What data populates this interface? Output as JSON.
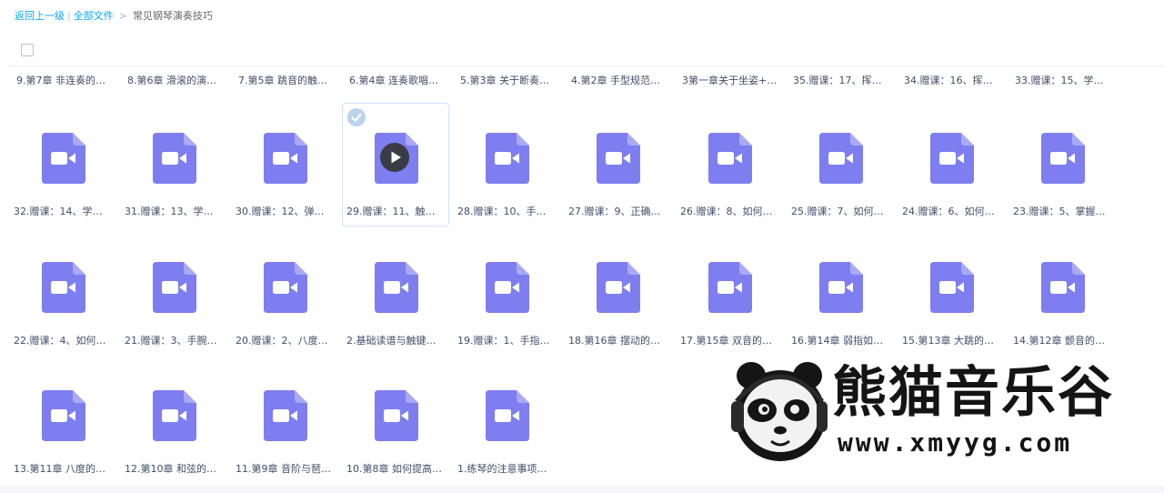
{
  "breadcrumb": {
    "back": "返回上一级",
    "separator": "|",
    "all_files": "全部文件",
    "chevron": ">",
    "current": "常见钢琴演奏技巧"
  },
  "top_row": [
    "9.第7章 非连奏的…",
    "8.第6章 滑滚的演…",
    "7.第5章 跳音的触…",
    "6.第4章 连奏歌唱…",
    "5.第3章 关于断奏…",
    "4.第2章 手型规范…",
    "3第一章关于坐姿+…",
    "35.赠课：17、挥…",
    "34.赠课：16、挥…",
    "33.赠课：15、学…"
  ],
  "rows": [
    [
      "32.赠课：14、学…",
      "31.赠课：13、学…",
      "30.赠课：12、弹…",
      "29.赠课：11、触…",
      "28.赠课：10、手…",
      "27.赠课：9、正确…",
      "26.赠课：8、如何…",
      "25.赠课：7、如何…",
      "24.赠课：6、如何…",
      "23.赠课：5、掌握…"
    ],
    [
      "22.赠课：4、如何…",
      "21.赠课：3、手腕…",
      "20.赠课：2、八度…",
      "2.基础读谱与触键…",
      "19.赠课：1、手指…",
      "18.第16章 摆动的…",
      "17.第15章 双音的…",
      "16.第14章 弱指如…",
      "15.第13章 大跳的…",
      "14.第12章 颤音的…"
    ],
    [
      "13.第11章 八度的…",
      "12.第10章 和弦的…",
      "11.第9章 音阶与琶…",
      "10.第8章 如何提高…",
      "1.练琴的注意事项…"
    ]
  ],
  "file_icon": "video-file-icon",
  "selected_file": "29.赠课：11、触…",
  "colors": {
    "accent": "#06a7ff",
    "file_icon": "#7e7ef0",
    "file_icon_fold": "#a9a9f6",
    "text": "#424e67"
  },
  "watermark": {
    "title": "熊猫音乐谷",
    "url": "www.xmyyg.com"
  }
}
